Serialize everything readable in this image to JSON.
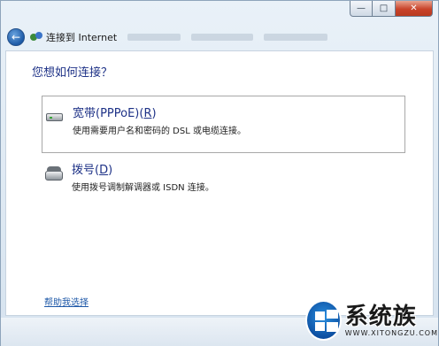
{
  "window": {
    "caption_buttons": {
      "minimize": "—",
      "maximize": "□",
      "close": "✕"
    }
  },
  "nav": {
    "back_icon": "back-arrow-icon",
    "title": "连接到 Internet"
  },
  "content": {
    "heading": "您想如何连接？",
    "options": [
      {
        "icon": "broadband-modem-icon",
        "title_prefix": "宽带(PPPoE)(",
        "title_key": "R",
        "title_suffix": ")",
        "description": "使用需要用户名和密码的 DSL 或电缆连接。",
        "selected": true
      },
      {
        "icon": "dialup-phone-icon",
        "title_prefix": "拨号(",
        "title_key": "D",
        "title_suffix": ")",
        "description": "使用拨号调制解调器或 ISDN 连接。",
        "selected": false
      }
    ],
    "help_link": "帮助我选择"
  },
  "watermark": {
    "brand": "系统族",
    "url": "WWW.XITONGZU.COM"
  },
  "colors": {
    "heading": "#1e3287",
    "link": "#1e58a8",
    "close_button": "#c8432a"
  }
}
